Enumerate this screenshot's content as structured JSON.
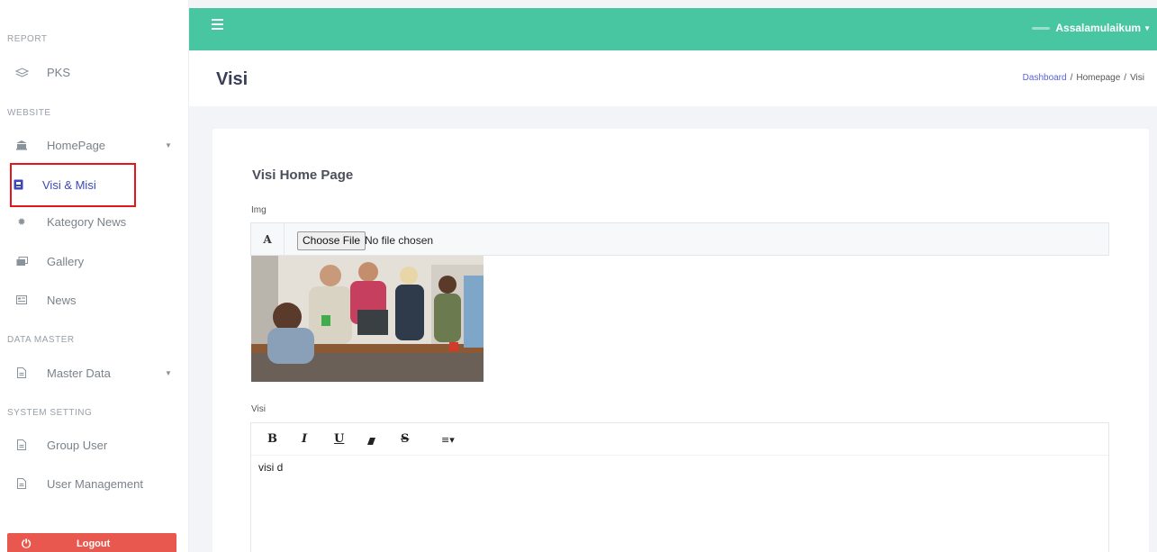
{
  "sidebar": {
    "sections": {
      "report": "REPORT",
      "website": "WEBSITE",
      "data_master": "DATA MASTER",
      "system_setting": "SYSTEM SETTING"
    },
    "items": {
      "pks": "PKS",
      "homepage": "HomePage",
      "visi_misi": "Visi & Misi",
      "kategory_news": "Kategory News",
      "gallery": "Gallery",
      "news": "News",
      "master_data": "Master Data",
      "group_user": "Group User",
      "user_management": "User Management"
    },
    "logout": "Logout"
  },
  "topbar": {
    "greeting": "Assalamulaikum",
    "accent_color": "#48c6a1"
  },
  "page": {
    "title": "Visi",
    "breadcrumb": [
      "Dashboard",
      "Homepage",
      "Visi"
    ]
  },
  "form": {
    "card_title": "Visi Home Page",
    "img_label": "Img",
    "file_prefix": "A",
    "file_button": "Choose File",
    "file_status": "No file chosen",
    "visi_label": "Visi",
    "toolbar": {
      "bold": "B",
      "italic": "I",
      "underline": "U",
      "strike": "S"
    },
    "editor_content": "visi d"
  },
  "icons": {
    "menu": "hamburger-icon",
    "logout": "power-icon"
  }
}
